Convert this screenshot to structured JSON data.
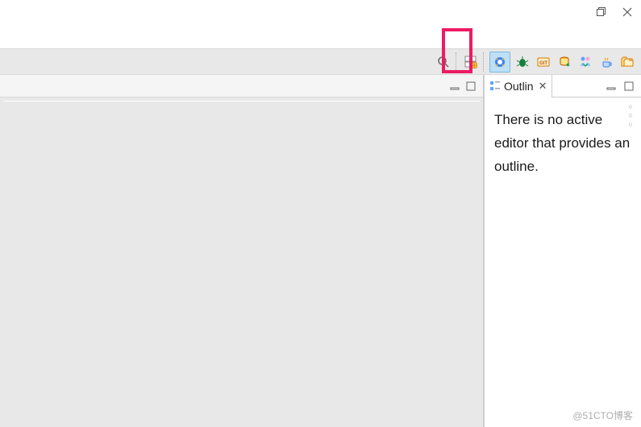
{
  "window": {
    "restore_tooltip": "Restore Down",
    "close_tooltip": "Close"
  },
  "toolbar": {
    "search_tooltip": "Search",
    "open_perspective_tooltip": "Open Perspective",
    "perspectives": {
      "java_ee": "Java EE",
      "debug": "Debug",
      "git": "Git",
      "svn_repo": "SVN Repository Exploring",
      "team_sync": "Team Synchronizing",
      "java": "Java",
      "resource": "Resource"
    }
  },
  "editor": {
    "minimize_tooltip": "Minimize",
    "maximize_tooltip": "Maximize"
  },
  "outline": {
    "tab_label": "Outlin",
    "minimize_tooltip": "Minimize",
    "maximize_tooltip": "Maximize",
    "view_menu_tooltip": "View Menu",
    "message": "There is no active editor that provides an outline."
  },
  "watermark": "@51CTO博客"
}
